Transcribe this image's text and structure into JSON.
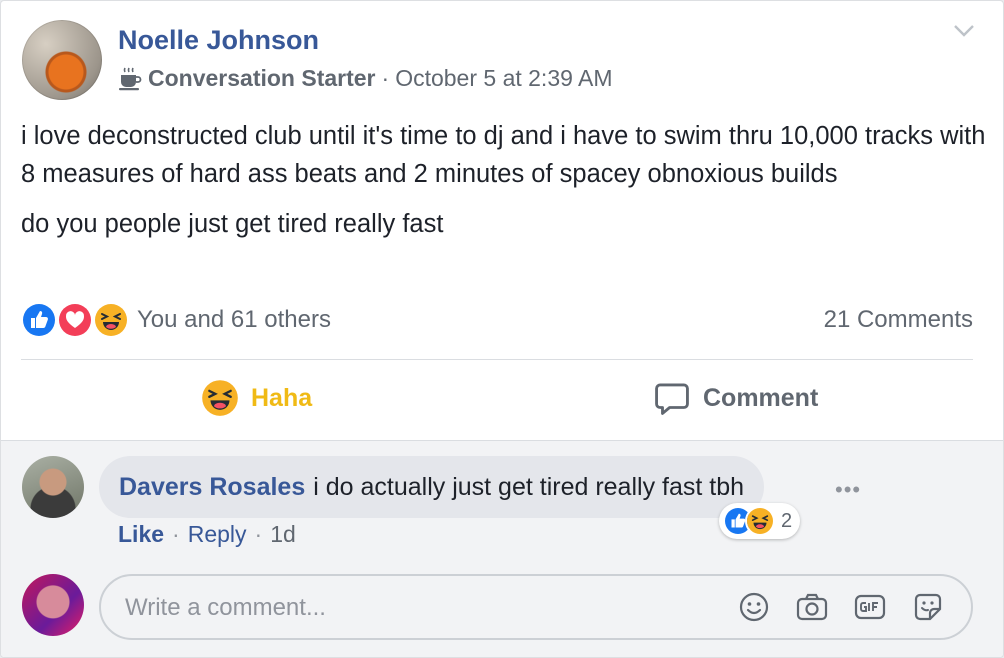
{
  "post": {
    "author": "Noelle Johnson",
    "badge": "Conversation Starter",
    "separator": "·",
    "timestamp": "October 5 at 2:39 AM",
    "paragraphs": [
      "i love deconstructed club until it's time to dj and i have to swim thru 10,000 tracks with 8 measures of hard ass beats and 2 minutes of spacey obnoxious builds",
      "do you people just get tired really fast"
    ],
    "reaction_icons": [
      "like-icon",
      "love-icon",
      "haha-icon"
    ],
    "reaction_summary": "You and 61 others",
    "comments_count": "21 Comments"
  },
  "actions": {
    "haha_label": "Haha",
    "comment_label": "Comment"
  },
  "comment": {
    "author": "Davers Rosales",
    "text": "i do actually just get tired really fast tbh",
    "like_label": "Like",
    "reply_label": "Reply",
    "time": "1d",
    "separator": "·",
    "reaction_count": "2",
    "more": "•••"
  },
  "composer": {
    "placeholder": "Write a comment...",
    "icons": [
      "emoji-icon",
      "camera-icon",
      "gif-icon",
      "sticker-icon"
    ]
  },
  "colors": {
    "link": "#385898",
    "haha_active": "#f0ba15",
    "muted": "#606770",
    "like_blue": "#1877f2",
    "love_red": "#f33e58"
  }
}
